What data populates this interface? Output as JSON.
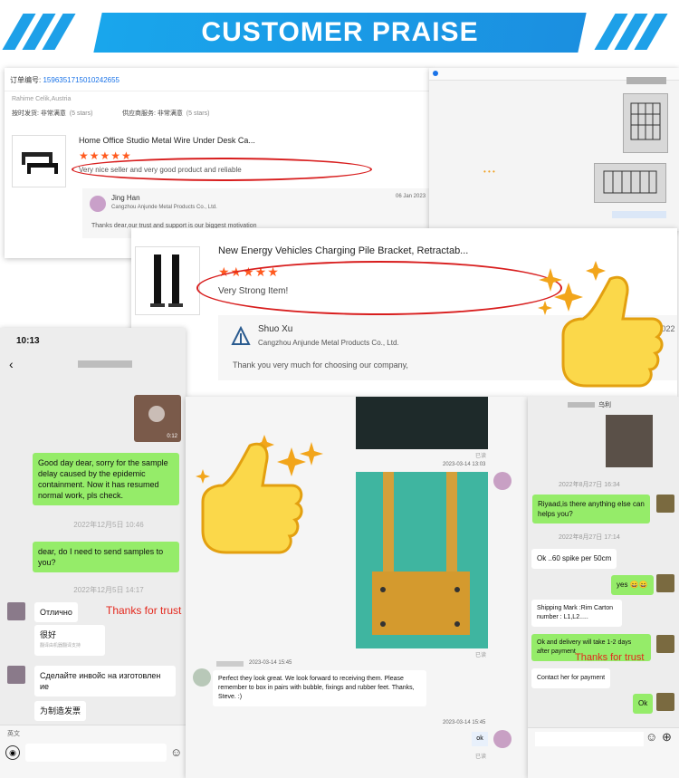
{
  "banner": {
    "title": "CUSTOMER PRAISE"
  },
  "order_card": {
    "order_label": "订单编号:",
    "order_number": "1596351715010242655",
    "buyer": "Rahime Celik,Austria",
    "ship_rating_label": "按时发货: 非常满意",
    "ship_rating_stars": "(5 stars)",
    "service_rating_label": "供应商服务: 非常满意",
    "service_rating_stars": "(5 stars)",
    "product_title": "Home Office Studio Metal Wire Under Desk Ca...",
    "stars": "★★★★★",
    "review": "Very nice seller and very good product and reliable",
    "reply_name": "Jing Han",
    "reply_company": "Cangzhou Anjunde Metal Products Co., Ltd.",
    "reply_date": "06 Jan 2023",
    "reply_text": "Thanks dear,our trust and support is our biggest motivation"
  },
  "review_card": {
    "product_title": "New Energy Vehicles Charging Pile Bracket, Retractab...",
    "stars": "★★★★★",
    "review": "Very Strong Item!",
    "reply_name": "Shuo Xu",
    "reply_company": "Cangzhou Anjunde Metal Products Co., Ltd.",
    "reply_date": "Sep 2022",
    "reply_text": "Thank you very much for choosing our company,"
  },
  "phone_left": {
    "clock": "10:13",
    "video_duration": "0:12",
    "msg1": "Good day dear, sorry for the sample delay caused by the epidemic containment. Now it has resumed normal work, pls check.",
    "time1": "2022年12月5日 10:46",
    "msg2": "dear, do I need to send samples to you?",
    "time2": "2022年12月5日 14:17",
    "msg3": "Отлично",
    "msg4": "很好",
    "msg4_note": "翻译由机器翻译支持",
    "msg5": "Сделайте инвойс на изготовлен ие",
    "msg6": "为制造发票",
    "lang": "英文",
    "thanks": "Thanks for trust"
  },
  "chat_middle": {
    "read1": "已读",
    "time1": "2023-03-14 13:03",
    "read2": "已读",
    "time2": "2023-03-14 15:45",
    "customer_msg": "Perfect they look great. We look forward to receiving them. Please remember to box in pairs with bubble, fixings and rubber feet. Thanks, Steve. :)",
    "time3": "2023-03-14 15:45",
    "ok": "ok",
    "read3": "已读"
  },
  "chat_right": {
    "contact": "乌利",
    "time1": "2022年8月27日 16:34",
    "msg1": "Riyaad,is there anything else can helps you?",
    "time2": "2022年8月27日 17:14",
    "msg2": "Ok ..60 spike per 50cm",
    "msg3": "yes",
    "msg4": "Shipping Mark :Rim Carton number : L1,L2.....",
    "msg5": "Ok and delivery will take 1-2 days after payment",
    "msg6": "Contact her for payment",
    "msg7": "Ok",
    "thanks": "Thanks for trust"
  },
  "chat_top_right": {
    "loading": "• • •"
  },
  "colors": {
    "accent": "#1ea0e8",
    "star": "#ff5a1f",
    "wechat_green": "#95ec69",
    "annotation_red": "#d81e1e"
  }
}
